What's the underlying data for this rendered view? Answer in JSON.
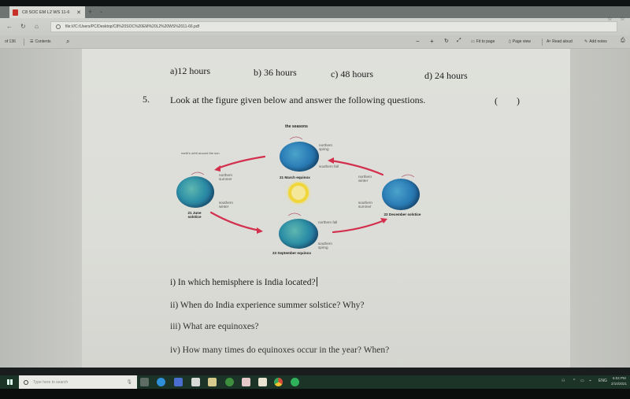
{
  "browser": {
    "tab_title": "C8 SOC EM L2 WS 11-6",
    "tab_close": "✕",
    "new_tab": "+",
    "tab_menu": "⌄",
    "address": "file:///C:/Users/PC/Desktop/C8%20SOC%20EM%20L2%20WS%2011-66.pdf",
    "back_icon": "←",
    "refresh_icon": "↻",
    "home_icon": "⌂",
    "favorite_icon": "☆",
    "favorites_bar_icon": "☆"
  },
  "pdf_toolbar": {
    "page_indicator": "of 136",
    "contents_label": "Contents",
    "search_icon": "⌕",
    "zoom_out": "−",
    "zoom_in": "+",
    "rotate_icon": "↻",
    "fullscreen_icon": "⤢",
    "fit_to_page": "Fit to page",
    "page_view": "Page view",
    "read_aloud": "Read aloud",
    "add_notes": "Add notes"
  },
  "document": {
    "options": [
      "a)12 hours",
      "b) 36 hours",
      "c) 48 hours",
      "d) 24 hours"
    ],
    "question_number": "5.",
    "question_text": "Look at the figure given below and answer the following questions.",
    "answer_bracket": "(        )",
    "figure": {
      "title": "the seasons",
      "orbit_label": "earth's orbit around the sun",
      "positions": [
        {
          "date": "21 March equinox",
          "north": "northern spring",
          "south": "southern fall"
        },
        {
          "date": "21 June solstice",
          "north": "northern summer",
          "south": "southern winter"
        },
        {
          "date": "23 September equinox",
          "north": "northern fall",
          "south": "southern spring"
        },
        {
          "date": "22 December solstice",
          "north": "northern winter",
          "south": "southern summer"
        }
      ]
    },
    "sub_questions": [
      "i) In which hemisphere is India located?",
      "ii) When do India experience summer solstice? Why?",
      "iii) What are equinoxes?",
      "iv) How many times do equinoxes occur in the year? When?"
    ]
  },
  "taskbar": {
    "search_placeholder": "Type here to search",
    "apps": [
      "task-view",
      "edge",
      "word",
      "mail",
      "file-explorer",
      "app-green",
      "pdf-reader",
      "store",
      "chrome",
      "whatsapp"
    ],
    "language": "ENG",
    "time": "6:04 PM",
    "date": "2/10/2021"
  }
}
